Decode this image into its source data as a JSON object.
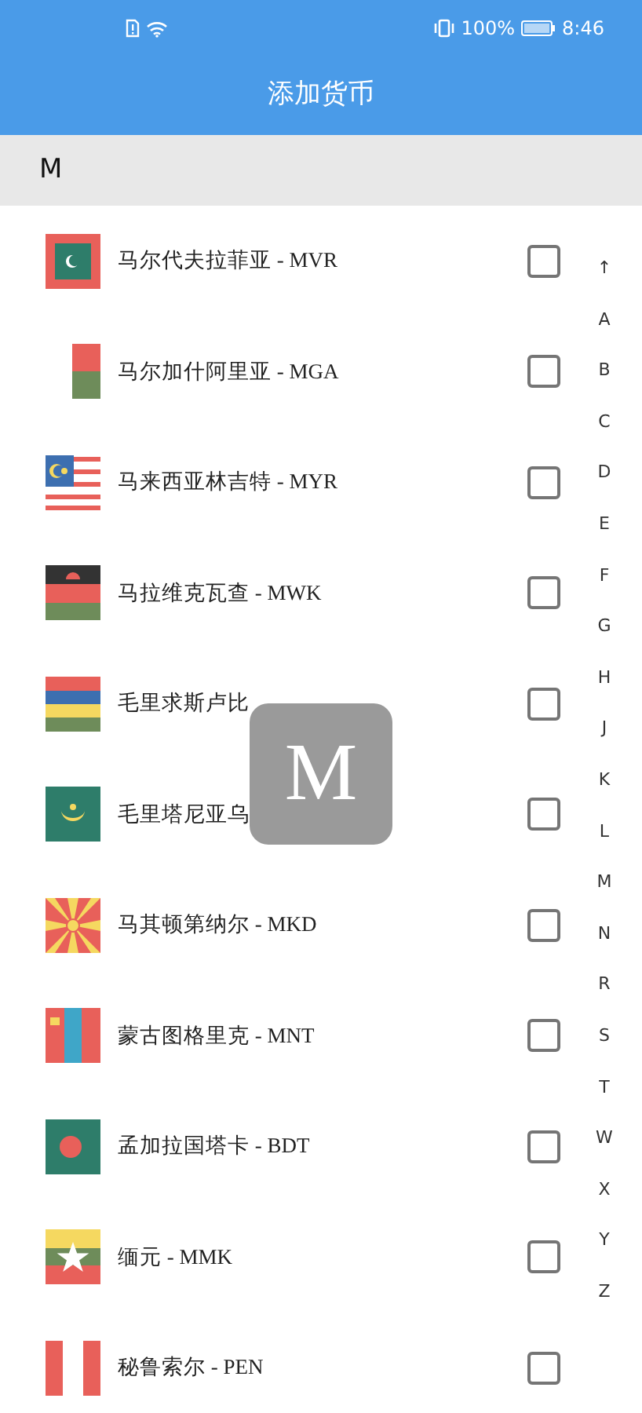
{
  "status_bar": {
    "battery": "100%",
    "time": "8:46"
  },
  "title": "添加货币",
  "section": {
    "letter": "M"
  },
  "currencies": [
    {
      "label": "马尔代夫拉菲亚 - MVR",
      "checked": false
    },
    {
      "label": "马尔加什阿里亚 - MGA",
      "checked": false
    },
    {
      "label": "马来西亚林吉特 - MYR",
      "checked": false
    },
    {
      "label": "马拉维克瓦查 - MWK",
      "checked": false
    },
    {
      "label": "毛里求斯卢比",
      "checked": false
    },
    {
      "label": "毛里塔尼亚乌",
      "checked": false
    },
    {
      "label": "马其顿第纳尔 - MKD",
      "checked": false
    },
    {
      "label": "蒙古图格里克 - MNT",
      "checked": false
    },
    {
      "label": "孟加拉国塔卡 - BDT",
      "checked": false
    },
    {
      "label": "缅元 - MMK",
      "checked": false
    },
    {
      "label": "秘鲁索尔 - PEN",
      "checked": false
    }
  ],
  "index_bar": [
    "↑",
    "A",
    "B",
    "C",
    "D",
    "E",
    "F",
    "G",
    "H",
    "J",
    "K",
    "L",
    "M",
    "N",
    "R",
    "S",
    "T",
    "W",
    "X",
    "Y",
    "Z"
  ],
  "letter_popup": "M"
}
